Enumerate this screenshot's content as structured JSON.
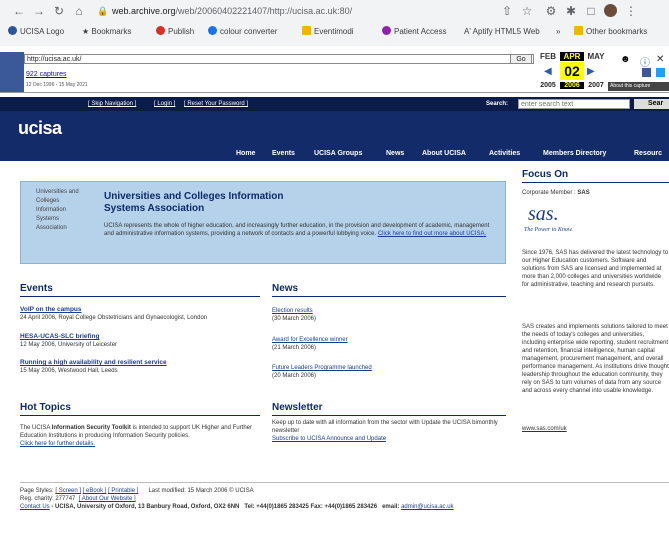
{
  "browser": {
    "address_host": "web.archive.org",
    "address_path": "/web/20060402221407/http://ucisa.ac.uk:80/",
    "bookmarks": [
      {
        "label": "UCISA Logo",
        "color": "#2b579a"
      },
      {
        "label": "Bookmarks",
        "color": "#5f6368"
      },
      {
        "label": "Publish",
        "color": "#d93025"
      },
      {
        "label": "colour converter",
        "color": "#1a73e8"
      },
      {
        "label": "Eventimodi",
        "color": "#f4b400"
      },
      {
        "label": "Patient Access",
        "color": "#8e24aa"
      },
      {
        "label": "Aptify HTML5 Web",
        "color": "#5f6368"
      }
    ],
    "other_bookmarks": "Other bookmarks"
  },
  "wayback": {
    "url_value": "http://ucisa.ac.uk/",
    "go_label": "Go",
    "captures": "922 captures",
    "range": "12 Dec 1996 - 15 May 2021",
    "months": [
      "FEB",
      "APR",
      "MAY"
    ],
    "day": "02",
    "years": [
      "2005",
      "2006",
      "2007"
    ],
    "about": "About this capture"
  },
  "site": {
    "topbar": {
      "skip": "[ Skip Navigation ]",
      "login": "[ Login ]",
      "reset": "[ Reset Your Password ]",
      "search_label": "Search:",
      "search_placeholder": "enter search text",
      "search_button": "Sear"
    },
    "logo": "ucisa",
    "nav": [
      "Home",
      "Events",
      "UCISA Groups",
      "News",
      "About UCISA",
      "Activities",
      "Members Directory",
      "Resourc"
    ],
    "intro": {
      "image_alt": "Universities and Colleges Information Systems Association",
      "title": "Universities and Colleges Information Systems Association",
      "text": "UCISA represents the whole of higher education, and increasingly further education, in the provision and development of academic, management and administrative information systems, providing a network of contacts and a powerful lobbying voice.",
      "link": "Click here to find out more about UCISA."
    },
    "events": {
      "heading": "Events",
      "items": [
        {
          "title": "VoIP on the campus",
          "detail": "24 April 2006, Royal College Obstetricians and Gynaecologist, London"
        },
        {
          "title": "HESA-UCAS-SLC briefing",
          "detail": "12 May 2006, University of Leicester"
        },
        {
          "title": "Running a high availability and resilient service",
          "detail": "15 May 2006, Westwood Hall, Leeds"
        }
      ]
    },
    "news": {
      "heading": "News",
      "items": [
        {
          "title": "Election results",
          "date": "(30 March 2006)"
        },
        {
          "title": "Award for Excellence winner",
          "date": "(21 March 2006)"
        },
        {
          "title": "Future Leaders Programme launched",
          "date": "(20 March 2006)"
        }
      ]
    },
    "hot_topics": {
      "heading": "Hot Topics",
      "pre": "The UCISA ",
      "bold": "Information Security Toolkit",
      "post": " is intended to support UK Higher and Further Education Institutions in producing Information Security policies.",
      "link": "Click here for further details."
    },
    "newsletter": {
      "heading": "Newsletter",
      "text": "Keep up to date with all information from the sector with Update the UCISA bimonthly newsletter",
      "link": "Subscribe to UCISA Announce and Update"
    },
    "focus": {
      "heading": "Focus On",
      "member_label": "Corporate Member : ",
      "member": "SAS",
      "sas_logo": "sas.",
      "sas_tagline": "The Power to Know.",
      "para1": "Since 1976, SAS has delivered the latest technology to our Higher Education customers. Software and solutions from SAS are licensed and implemented at more than 2,000 colleges and universities worldwide for administrative, teaching and research pursuits.",
      "para2": "SAS creates and implements solutions tailored to meet the needs of today's colleges and universities, including enterprise wide reporting, student recruitment and retention, financial intelligence, human capital management, procurement management, and overall performance management. As institutions drive thought leadership throughout the education community, they rely on SAS to turn volumes of data from any source and across every channel into usable knowledge.",
      "link": "www.sas.com/uk"
    },
    "footer": {
      "styles_label": "Page Styles: ",
      "screen": "[ Screen ]",
      "ebook": "[ eBook ]",
      "printable": "[ Printable ]",
      "modified": "Last modified: 15 March 2006  © UCISA",
      "charity": "Reg. charity: 277747",
      "about_site": "[ About Our Website ]",
      "contact": "Contact Us",
      "address": " - UCISA, University of Oxford, 13 Banbury Road, Oxford, OX2 6NN",
      "tel": "Tel: +44(0)1865 283425 Fax: +44(0)1865 283426",
      "email_label": "email: ",
      "email": "admin@ucisa.ac.uk"
    }
  }
}
